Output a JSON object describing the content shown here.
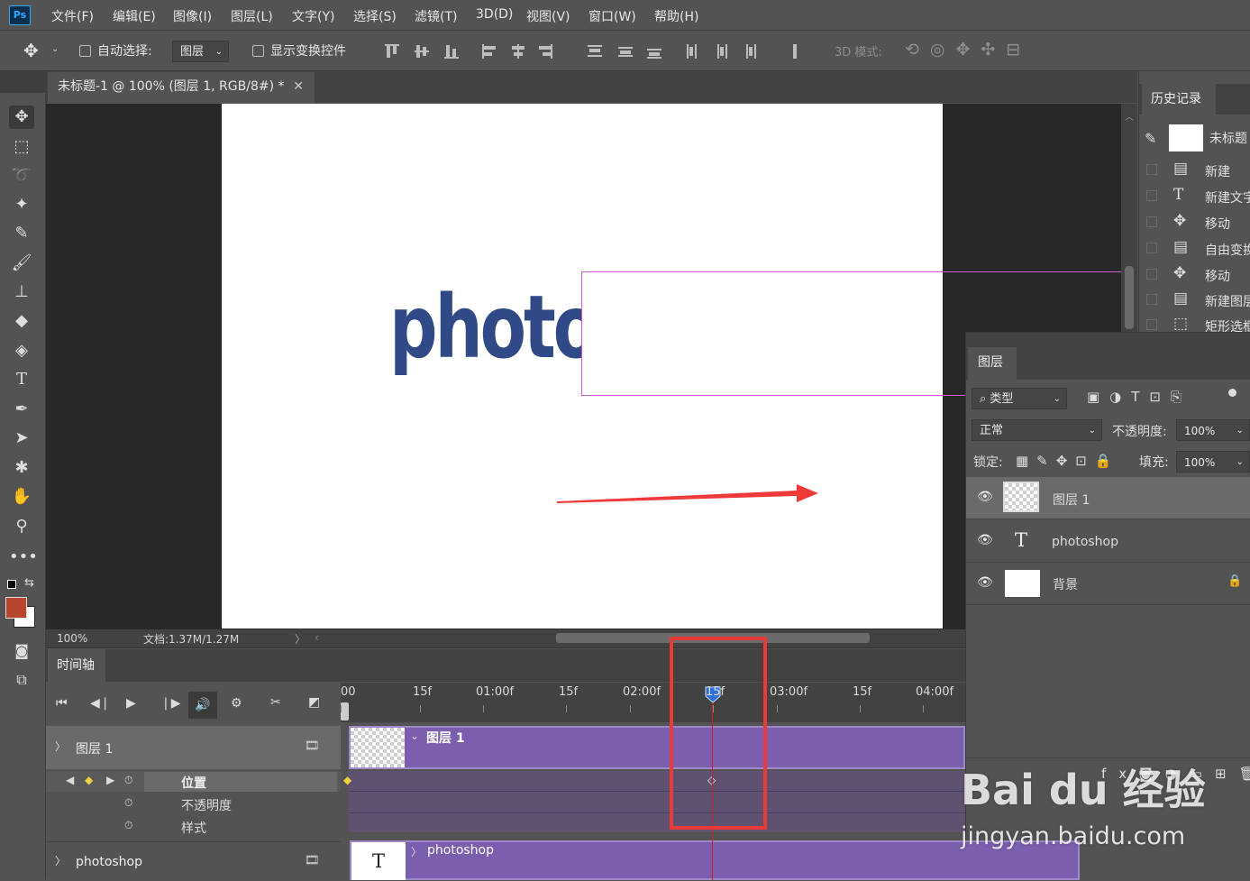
{
  "menubar": {
    "logo": "Ps",
    "items": [
      "文件(F)",
      "编辑(E)",
      "图像(I)",
      "图层(L)",
      "文字(Y)",
      "选择(S)",
      "滤镜(T)",
      "3D(D)",
      "视图(V)",
      "窗口(W)",
      "帮助(H)"
    ]
  },
  "options": {
    "auto_select_label": "自动选择:",
    "auto_select_target": "图层",
    "show_transform_label": "显示变换控件",
    "mode3d_label": "3D 模式:"
  },
  "document": {
    "tab_title": "未标题-1 @ 100% (图层 1, RGB/8#) *",
    "canvas_text": "photo",
    "zoom": "100%",
    "doc_info": "文档:1.37M/1.27M"
  },
  "history": {
    "tab": "历史记录",
    "snapshot": "未标题",
    "items": [
      {
        "icon": "document-icon",
        "label": "新建"
      },
      {
        "icon": "type-icon",
        "label": "新建文字"
      },
      {
        "icon": "move-icon",
        "label": "移动"
      },
      {
        "icon": "document-icon",
        "label": "自由变换"
      },
      {
        "icon": "move-icon",
        "label": "移动"
      },
      {
        "icon": "document-icon",
        "label": "新建图层"
      },
      {
        "icon": "marquee-icon",
        "label": "矩形选框"
      }
    ]
  },
  "layers": {
    "tab": "图层",
    "filter": "类型",
    "blend_mode": "正常",
    "opacity_label": "不透明度:",
    "opacity": "100%",
    "lock_label": "锁定:",
    "fill_label": "填充:",
    "fill": "100%",
    "items": [
      {
        "name": "图层 1",
        "selected": true
      },
      {
        "name": "photoshop",
        "type": "text"
      },
      {
        "name": "背景",
        "locked": true
      }
    ]
  },
  "timeline": {
    "tab": "时间轴",
    "ruler": [
      "00",
      "15f",
      "01:00f",
      "15f",
      "02:00f",
      "15f",
      "03:00f",
      "15f",
      "04:00f"
    ],
    "track1": {
      "name": "图层 1",
      "props": [
        "位置",
        "不透明度",
        "样式"
      ]
    },
    "track2": {
      "name": "photoshop"
    },
    "clip1_label": "图层 1",
    "clip2_label": "photoshop"
  },
  "watermark": {
    "brand": "Bai du 经验",
    "url": "jingyan.baidu.com"
  },
  "colors": {
    "accent": "#31a8ff",
    "clip": "#7b5eae",
    "highlight": "#e93a3a",
    "text_blue": "#2f4a86",
    "arrow": "#f03a3a"
  }
}
